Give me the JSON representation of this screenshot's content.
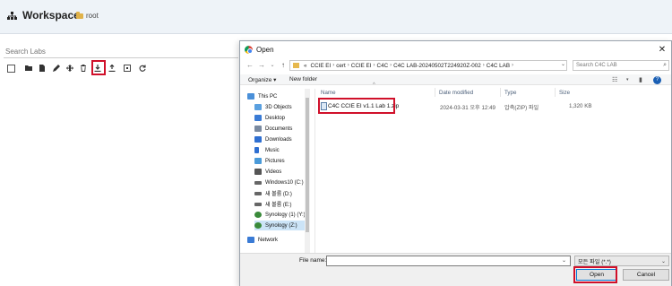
{
  "workspace": {
    "title": "Workspace",
    "root_label": "root",
    "search_placeholder": "Search Labs"
  },
  "dialog": {
    "title": "Open",
    "close": "✕",
    "nav": {
      "back": "←",
      "forward": "→",
      "up": "↑",
      "recent": "⌄"
    },
    "breadcrumb": [
      "«",
      "CCIE EI",
      "cert",
      "CCIE EI",
      "C4C",
      "C4C LAB-20240502T224920Z-002",
      "C4C LAB"
    ],
    "breadcrumb_sep": "›",
    "address_dropdown": "⌄",
    "search_placeholder": "Search C4C LAB",
    "organize": "Organize ▾",
    "new_folder": "New folder",
    "help": "?",
    "sidebar": [
      {
        "label": "This PC",
        "icon": "pc-icon",
        "color": "#4a90d9"
      },
      {
        "label": "3D Objects",
        "icon": "cube-icon",
        "color": "#5aa0e0"
      },
      {
        "label": "Desktop",
        "icon": "desktop-icon",
        "color": "#3a7bd5"
      },
      {
        "label": "Documents",
        "icon": "document-icon",
        "color": "#7a8aa0"
      },
      {
        "label": "Downloads",
        "icon": "download-icon",
        "color": "#2f6fd1"
      },
      {
        "label": "Music",
        "icon": "music-icon",
        "color": "#2f6fd1"
      },
      {
        "label": "Pictures",
        "icon": "picture-icon",
        "color": "#4a9ad9"
      },
      {
        "label": "Videos",
        "icon": "video-icon",
        "color": "#555555"
      },
      {
        "label": "Windows10 (C:)",
        "icon": "drive-icon",
        "color": "#666666"
      },
      {
        "label": "새 볼륨 (D:)",
        "icon": "drive-icon",
        "color": "#666666"
      },
      {
        "label": "새 볼륨 (E:)",
        "icon": "drive-icon",
        "color": "#666666"
      },
      {
        "label": "Synology (1) (Y:)",
        "icon": "network-drive-icon",
        "color": "#3a8a3a"
      },
      {
        "label": "Synology (Z:)",
        "icon": "network-drive-icon",
        "color": "#3a8a3a"
      },
      {
        "label": "Network",
        "icon": "network-icon",
        "color": "#3a7bd5"
      }
    ],
    "columns": {
      "name": "Name",
      "date": "Date modified",
      "type": "Type",
      "size": "Size",
      "sort_arrow": "^"
    },
    "files": [
      {
        "name": "C4C CCIE EI v1.1 Lab 1.zip",
        "date": "2024-03-31 오후 12:49",
        "type": "압축(ZIP) 파일",
        "size": "1,320 KB"
      }
    ],
    "file_name_label": "File name:",
    "file_name_value": "",
    "file_type": "모든 파일 (*.*)",
    "open": "Open",
    "cancel": "Cancel"
  },
  "colors": {
    "highlight": "#d0102a",
    "accent": "#0078d7",
    "header_bg": "#eef3f8"
  }
}
